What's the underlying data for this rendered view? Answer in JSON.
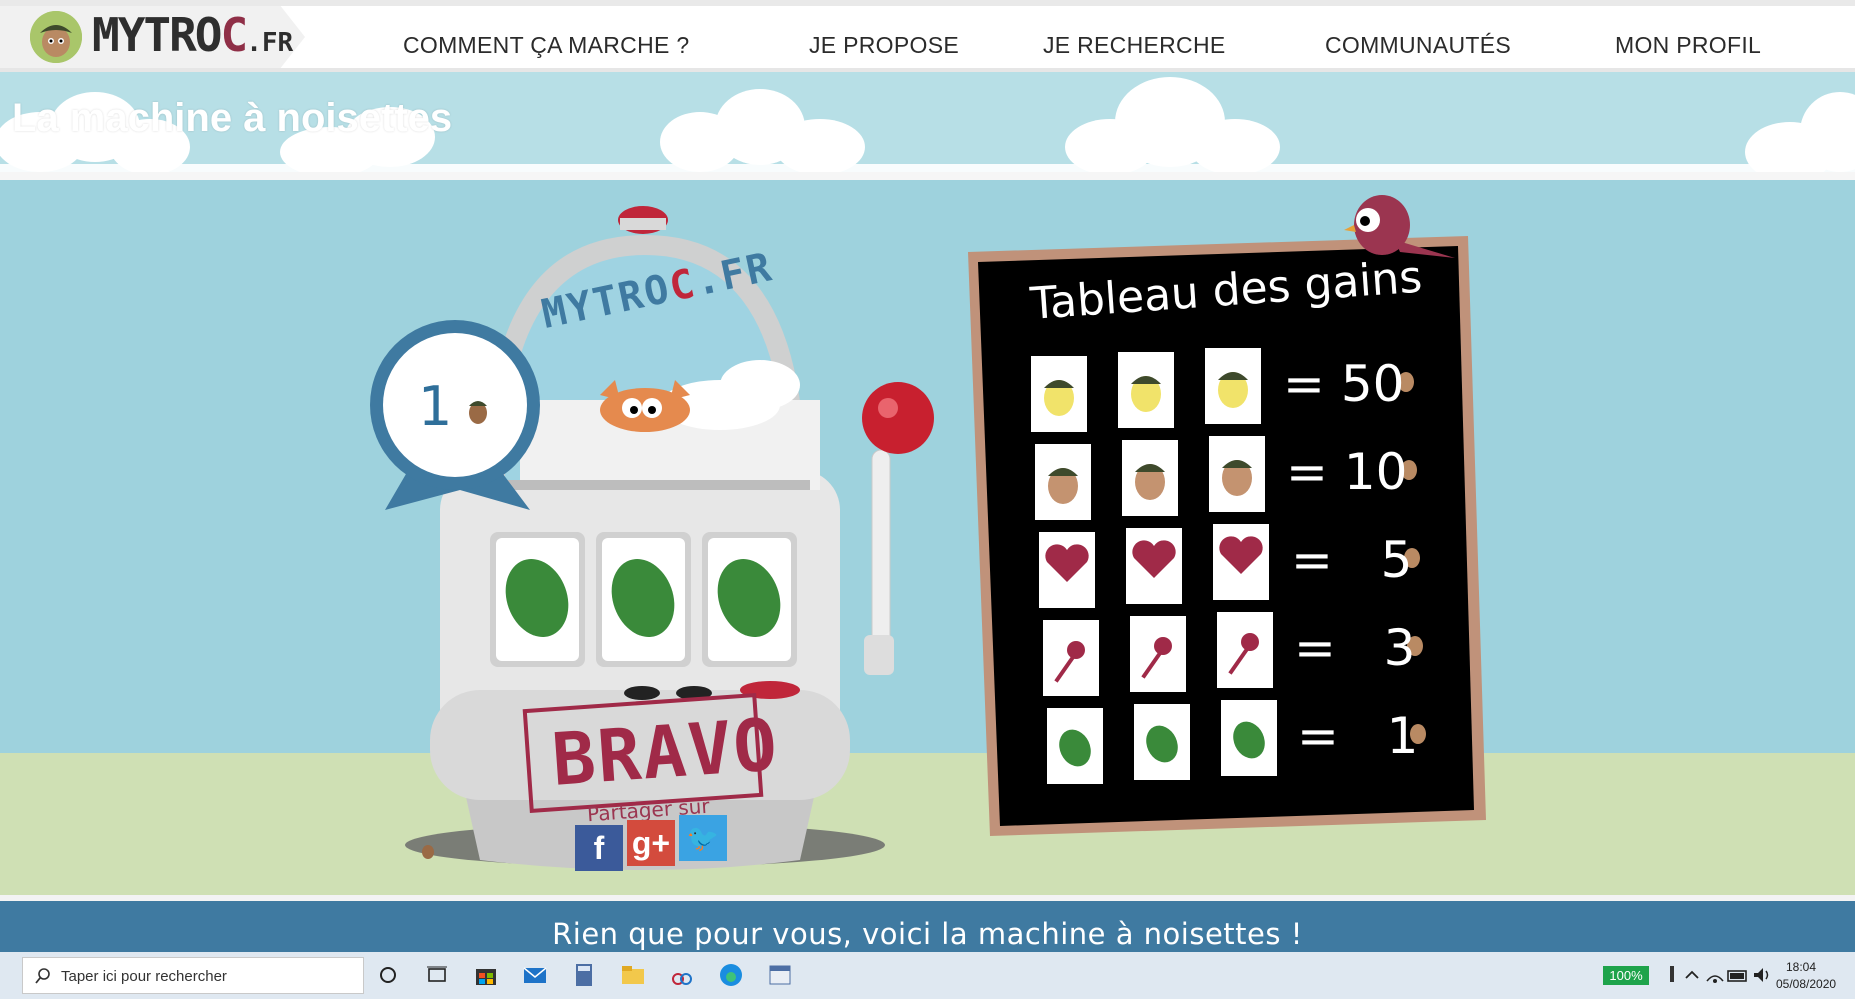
{
  "logo": {
    "brand_main": "MYTRO",
    "brand_accent": "C",
    "brand_suffix": ".FR"
  },
  "nav": {
    "items": [
      {
        "label": "COMMENT ÇA MARCHE ?"
      },
      {
        "label": "JE PROPOSE"
      },
      {
        "label": "JE RECHERCHE"
      },
      {
        "label": "COMMUNAUTÉS"
      },
      {
        "label": "MON PROFIL"
      }
    ]
  },
  "header": {
    "title": "La machine à noisettes"
  },
  "machine": {
    "dome_brand_main": "MYTRO",
    "dome_brand_accent": "C",
    "dome_brand_suffix": ".FR",
    "prize_value": "1",
    "reels": [
      "leaf-icon",
      "leaf-icon",
      "leaf-icon"
    ],
    "result_stamp": "BRAVO",
    "share_label": "Partager sur",
    "share_buttons": [
      {
        "icon": "facebook-icon",
        "glyph": "f",
        "color": "#3b5a9a"
      },
      {
        "icon": "google-plus-icon",
        "glyph": "g+",
        "color": "#d34b3d"
      },
      {
        "icon": "twitter-icon",
        "glyph": "🐦",
        "color": "#3aa3e3"
      }
    ]
  },
  "payout_board": {
    "title": "Tableau des gains",
    "rows": [
      {
        "symbol": "golden-hazelnut-icon",
        "value": "50"
      },
      {
        "symbol": "hazelnut-icon",
        "value": "10"
      },
      {
        "symbol": "heart-icon",
        "value": "5"
      },
      {
        "symbol": "bird-icon",
        "value": "3"
      },
      {
        "symbol": "leaf-icon",
        "value": "1"
      }
    ],
    "operator": "="
  },
  "banner": {
    "text": "Rien que pour vous, voici la machine à noisettes !"
  },
  "taskbar": {
    "search_placeholder": "Taper ici pour rechercher",
    "battery_percent": "100%",
    "time": "18:04",
    "date": "05/08/2020"
  },
  "colors": {
    "sky": "#9ed2dd",
    "ground": "#cfe0b4",
    "banner": "#3f7aa1",
    "brand_red": "#8f2f47",
    "board": "#000000",
    "board_frame": "#c0927a"
  }
}
